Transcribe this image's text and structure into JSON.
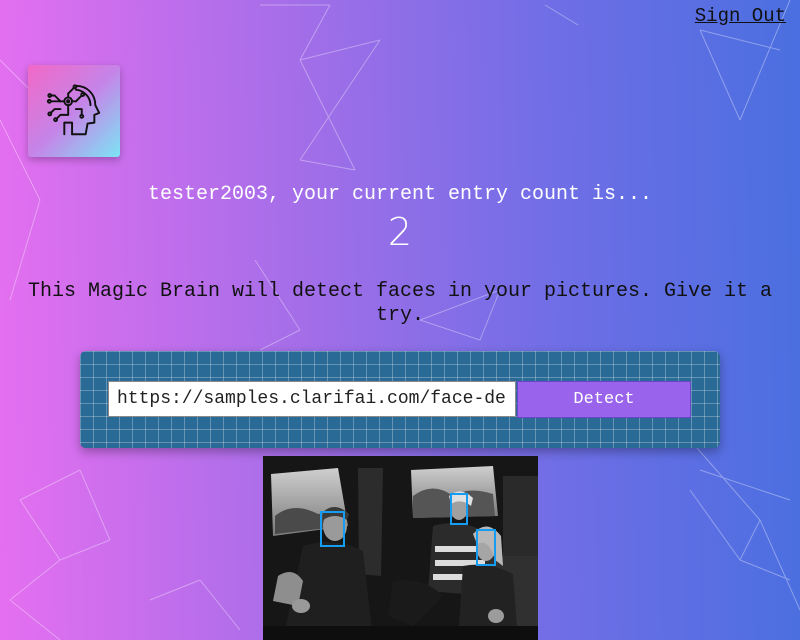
{
  "header": {
    "sign_out_label": "Sign Out"
  },
  "logo": {
    "icon": "brain-circuit-head-icon"
  },
  "rank": {
    "message": "tester2003, your current entry count is...",
    "count": "2"
  },
  "intro": {
    "text": "This Magic Brain will detect faces in your pictures. Give it a try."
  },
  "form": {
    "url_value": "https://samples.clarifai.com/face-det.jpg",
    "detect_label": "Detect"
  },
  "result": {
    "face_box_count": 3
  },
  "colors": {
    "panel": "#2a6a97",
    "button": "#9a63ec",
    "face_box": "#149df2"
  }
}
